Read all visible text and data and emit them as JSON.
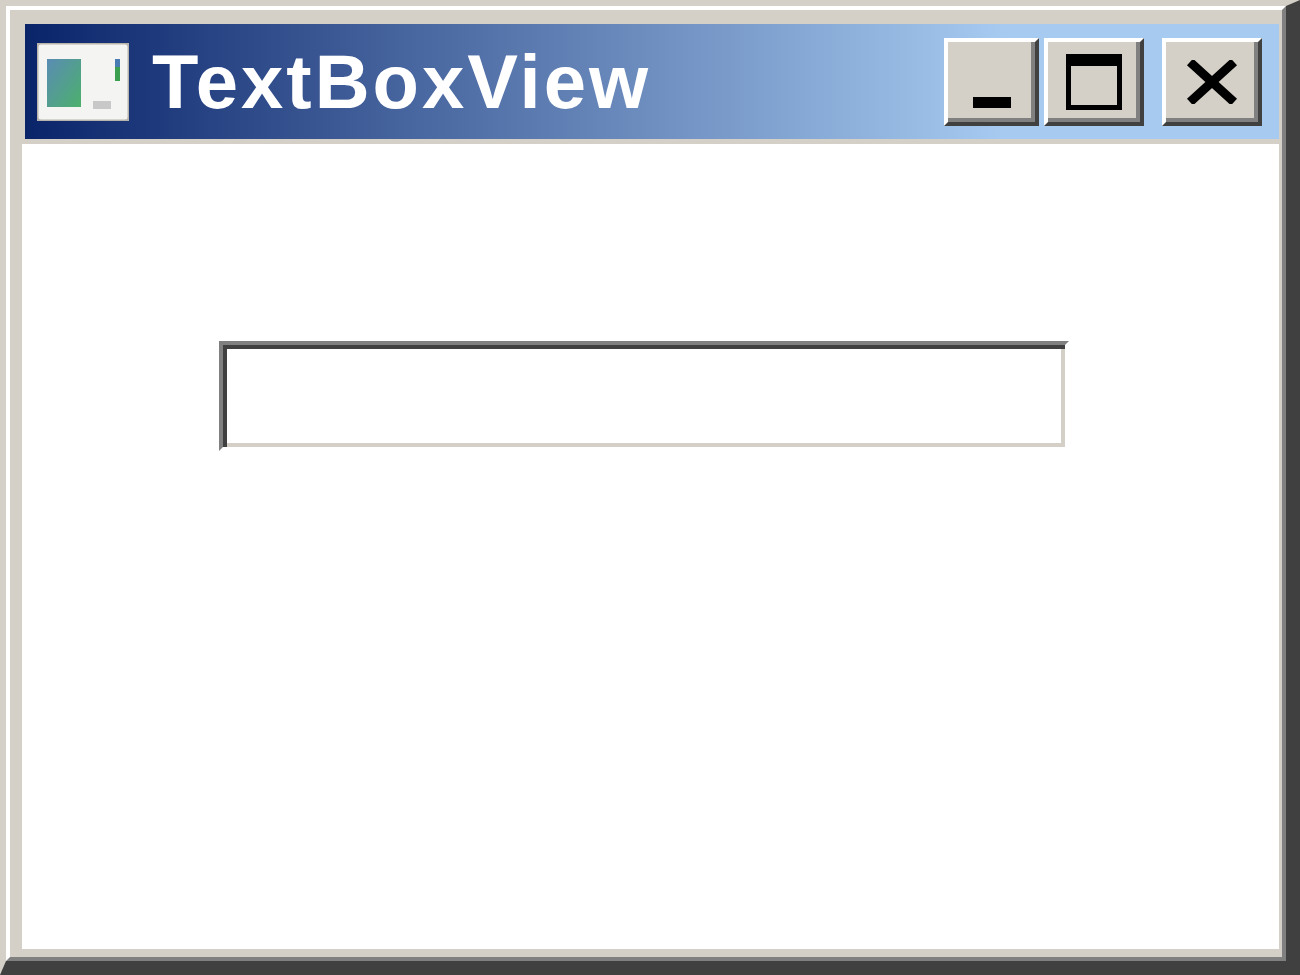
{
  "window": {
    "title": "TextBoxView"
  }
}
